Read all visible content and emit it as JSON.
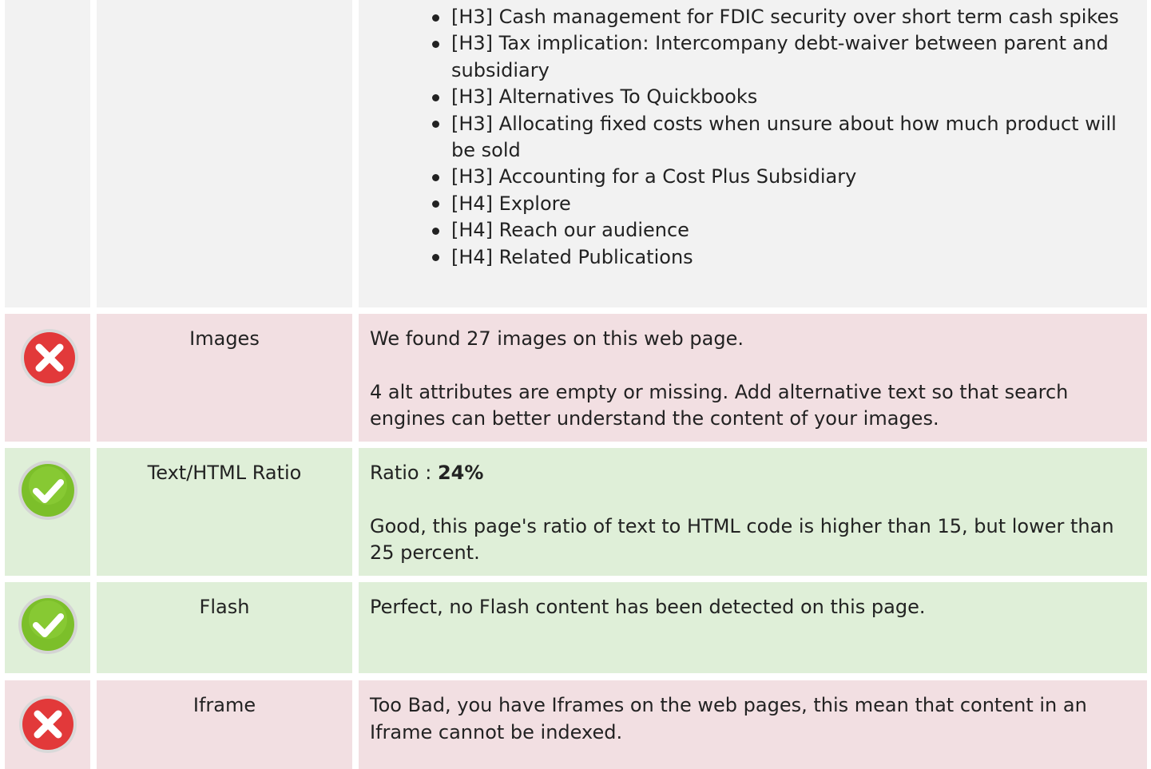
{
  "headings_list": [
    "[H3] Cash management for FDIC security over short term cash spikes",
    "[H3] Tax implication: Intercompany debt-waiver between parent and subsidiary",
    "[H3] Alternatives To Quickbooks",
    "[H3] Allocating fixed costs when unsure about how much product will be sold",
    "[H3] Accounting for a Cost Plus Subsidiary",
    "[H4] Explore",
    "[H4] Reach our audience",
    "[H4] Related Publications"
  ],
  "rows": {
    "images": {
      "status": "error",
      "label": "Images",
      "line1": "We found 27 images on this web page.",
      "line2": "4 alt attributes are empty or missing. Add alternative text so that search engines can better understand the content of your images."
    },
    "ratio": {
      "status": "ok",
      "label": "Text/HTML Ratio",
      "ratio_prefix": "Ratio : ",
      "ratio_value": "24%",
      "line2": "Good, this page's ratio of text to HTML code is higher than 15, but lower than 25 percent."
    },
    "flash": {
      "status": "ok",
      "label": "Flash",
      "line1": "Perfect, no Flash content has been detected on this page."
    },
    "iframe": {
      "status": "error",
      "label": "Iframe",
      "line1": "Too Bad, you have Iframes on the web pages, this mean that content in an Iframe cannot be indexed."
    }
  },
  "icons": {
    "error": "error-x-icon",
    "ok": "check-icon"
  },
  "colors": {
    "error_bg": "#f2dfe2",
    "ok_bg": "#dfefd8",
    "neutral_bg": "#f2f2f2",
    "error_icon": "#e2393a",
    "ok_icon": "#7cbf2a"
  }
}
